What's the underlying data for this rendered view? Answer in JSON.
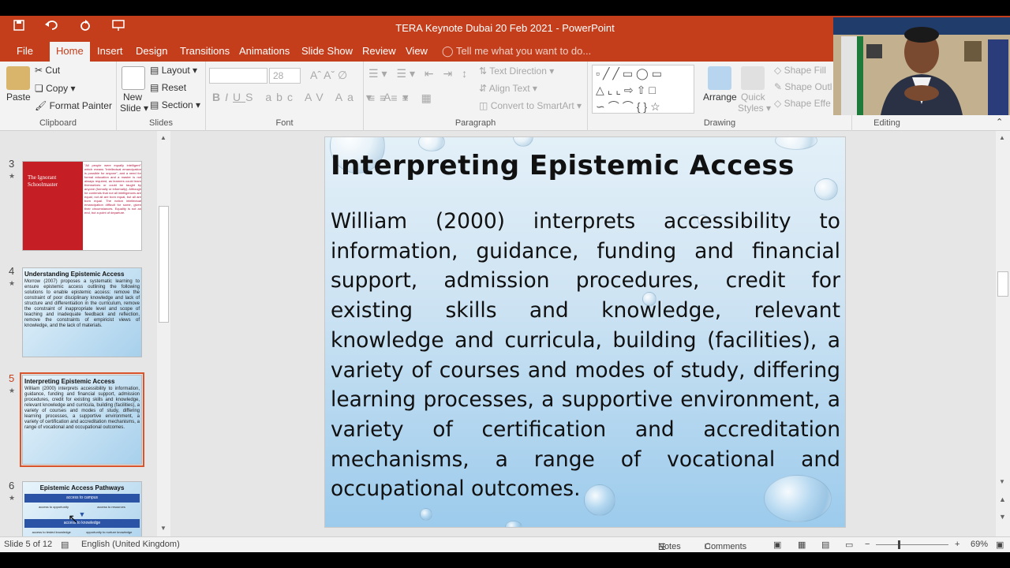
{
  "window": {
    "title": "TERA Keynote Dubai 20 Feb 2021 - PowerPoint"
  },
  "qat": {
    "save_icon": "save-icon",
    "undo_icon": "undo-icon",
    "redo_icon": "redo-icon",
    "customize_icon": "presentation-icon"
  },
  "tabs": [
    {
      "label": "File"
    },
    {
      "label": "Home"
    },
    {
      "label": "Insert"
    },
    {
      "label": "Design"
    },
    {
      "label": "Transitions"
    },
    {
      "label": "Animations"
    },
    {
      "label": "Slide Show"
    },
    {
      "label": "Review"
    },
    {
      "label": "View"
    }
  ],
  "tell_me": "Tell me what you want to do...",
  "ribbon": {
    "clipboard": {
      "paste": "Paste",
      "cut": "Cut",
      "copy": "Copy",
      "format_painter": "Format Painter",
      "label": "Clipboard"
    },
    "slides": {
      "new_slide": "New",
      "new_slide2": "Slide",
      "layout": "Layout",
      "reset": "Reset",
      "section": "Section",
      "label": "Slides"
    },
    "font": {
      "font_size": "28",
      "label": "Font"
    },
    "paragraph": {
      "text_direction": "Text Direction",
      "align_text": "Align Text",
      "convert_smartart": "Convert to SmartArt",
      "label": "Paragraph"
    },
    "drawing": {
      "arrange": "Arrange",
      "quick_styles": "Quick",
      "quick_styles2": "Styles",
      "shape_fill": "Shape Fill",
      "shape_outline": "Shape Outl",
      "shape_effects": "Shape Effe",
      "label": "Drawing"
    },
    "editing": {
      "label": "Editing"
    }
  },
  "thumbnails": [
    {
      "number": "3",
      "title": "The Ignorant Schoolmaster",
      "body": "\"All people were equally intelligent\" which means \"intellectual emancipation is possible for anyone\", and a need for formal education and a master is not always required, as learners could learn themselves or could be taught by anyone (formally or informally). Although he contends that not all intelligences are equal, not all are born equal, but all are born equal. The notion intellectual emancipation difficult for some, given their circumstances. Equality is not an end, but a point of departure."
    },
    {
      "number": "4",
      "title": "Understanding Epistemic Access",
      "body": "Morrow (2007) proposes a systematic learning to ensure epistemic access outlining the following solutions to enable epistemic access: remove the constraint of poor disciplinary knowledge and lack of structure and differentiation in the curriculum, remove the constraint of inappropriate level and scope of teaching and inadequate feedback and reflection, remove the constraints of empiricist views of knowledge, and the lack of materials."
    },
    {
      "number": "5",
      "title": "Interpreting Epistemic Access",
      "body": "William (2000) interprets accessibility to information, guidance, funding and financial support, admission procedures, credit for existing skills and knowledge, relevant knowledge and curricula, building (facilities), a variety of courses and modes of study, differing learning processes, a supportive environment, a variety of certification and accreditation mechanisms, a range of vocational and occupational outcomes."
    },
    {
      "number": "6",
      "title": "Epistemic Access Pathways",
      "body": "",
      "boxes": [
        "access to campus",
        "access to opportunity",
        "access to resources",
        "access to knowledge",
        "access to tested knowledge",
        "opportunity to nurture knowledge"
      ]
    }
  ],
  "slide": {
    "title": "Interpreting Epistemic Access",
    "body": "William (2000) interprets accessibility to information, guidance, funding and financial support, admission procedures, credit for existing skills and knowledge, relevant knowledge and curricula, building (facilities), a variety of courses and modes of study, differing learning processes, a supportive environment, a variety of certification and accreditation mechanisms, a range of vocational and occupational outcomes."
  },
  "status": {
    "slide_info": "Slide 5 of 12",
    "language": "English (United Kingdom)",
    "notes": "Notes",
    "comments": "Comments",
    "zoom": "69%",
    "zoom_level": 0.69
  },
  "colors": {
    "accent": "#c43e1c",
    "selection": "#d9542b"
  }
}
